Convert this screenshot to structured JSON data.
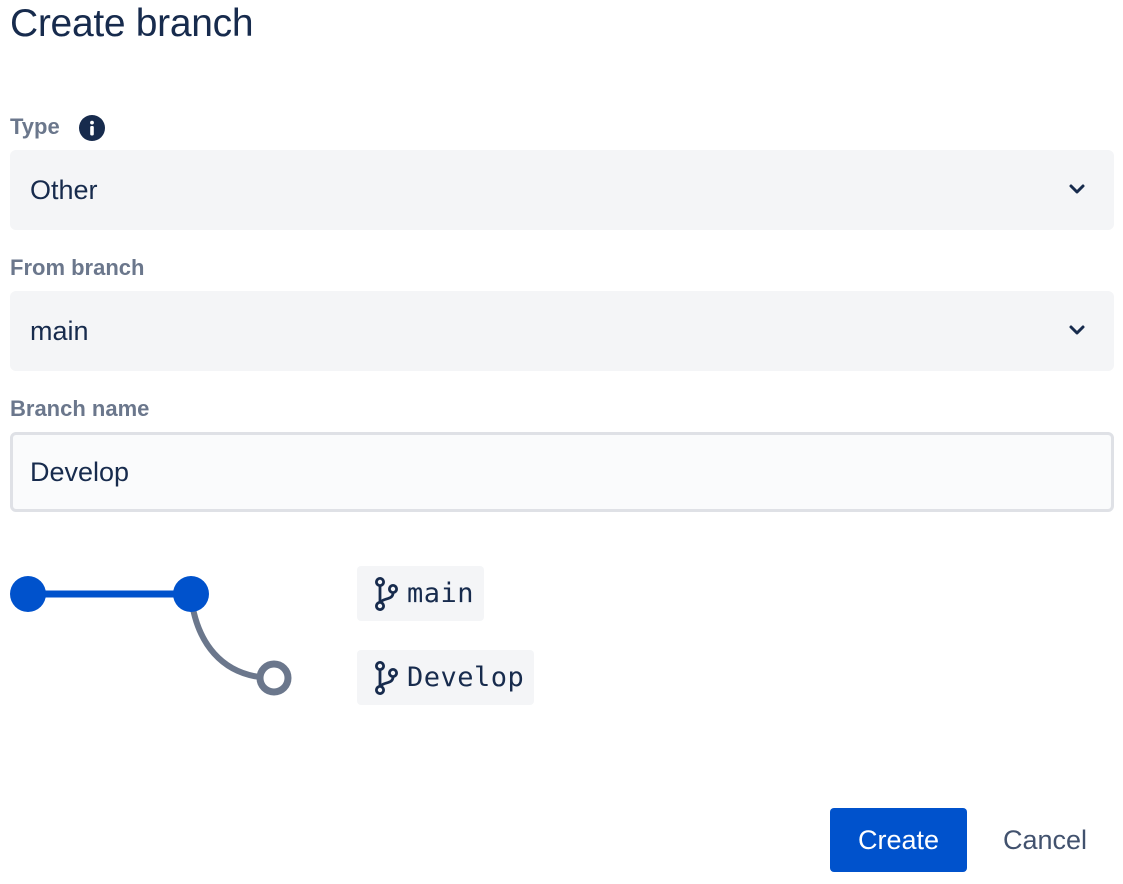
{
  "dialog": {
    "title": "Create branch"
  },
  "form": {
    "type": {
      "label": "Type",
      "info_icon": "info-icon",
      "selected": "Other"
    },
    "from_branch": {
      "label": "From branch",
      "selected": "main"
    },
    "branch_name": {
      "label": "Branch name",
      "value": "Develop"
    }
  },
  "diagram": {
    "source_branch": "main",
    "new_branch": "Develop",
    "branch_icon": "git-branch-icon",
    "colors": {
      "source_line": "#0052cc",
      "new_line": "#6b778c"
    }
  },
  "actions": {
    "create_label": "Create",
    "cancel_label": "Cancel"
  },
  "colors": {
    "primary": "#0052cc",
    "text": "#172b4d",
    "label": "#6b778c",
    "field_bg": "#f4f5f7"
  }
}
